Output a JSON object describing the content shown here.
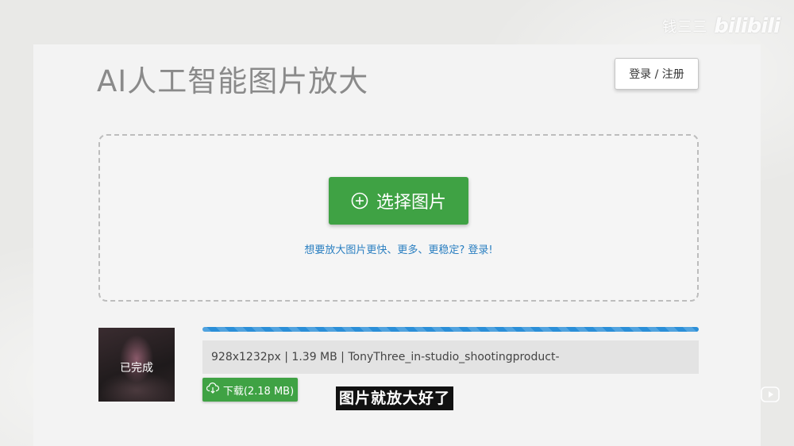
{
  "watermark": {
    "channel": "钱三三",
    "logo": "bilibili"
  },
  "header": {
    "title": "AI人工智能图片放大",
    "login_label": "登录 / 注册"
  },
  "upload": {
    "select_label": "选择图片",
    "hint": "想要放大图片更快、更多、更稳定? 登录!"
  },
  "task": {
    "thumbnail_status": "已完成",
    "progress": 1.0,
    "file_info": "928x1232px | 1.39 MB | TonyThree_in-studio_shootingproduct-",
    "download_label": "下载(2.18 MB)"
  },
  "video": {
    "subtitle": "图片就放大好了"
  },
  "colors": {
    "accent_green": "#3fa244",
    "progress_blue": "#2b8fd8",
    "link_blue": "#2a7fc1"
  },
  "icons": [
    "plus-circle-icon",
    "cloud-download-icon",
    "play-icon"
  ]
}
